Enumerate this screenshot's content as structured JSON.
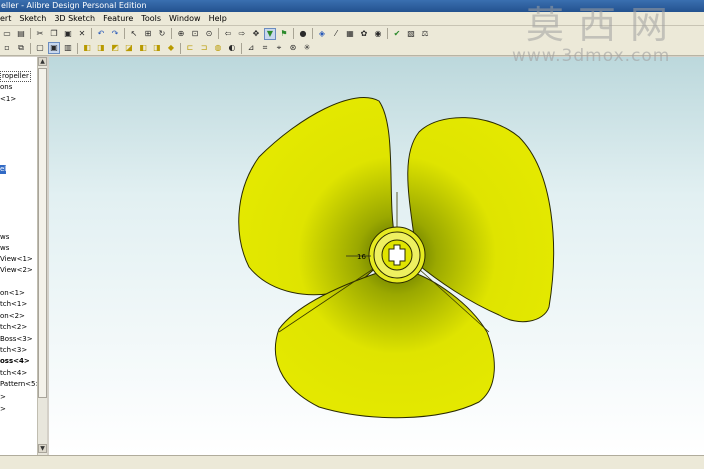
{
  "window": {
    "title": "eller - Alibre Design Personal Edition"
  },
  "menu": [
    {
      "id": "insert",
      "label": "ert"
    },
    {
      "id": "sketch",
      "label": "Sketch"
    },
    {
      "id": "3d-sketch",
      "label": "3D Sketch"
    },
    {
      "id": "feature",
      "label": "Feature"
    },
    {
      "id": "tools",
      "label": "Tools"
    },
    {
      "id": "window",
      "label": "Window"
    },
    {
      "id": "help",
      "label": "Help"
    }
  ],
  "tree": {
    "items": [
      {
        "label": "ropeller"
      },
      {
        "label": "ons"
      },
      {
        "label": "<1>"
      },
      {
        "label": "el"
      },
      {
        "label": "ws"
      },
      {
        "label": "ws"
      },
      {
        "label": "View<1>"
      },
      {
        "label": "View<2>"
      },
      {
        "label": "on<1>"
      },
      {
        "label": "tch<1>"
      },
      {
        "label": "on<2>"
      },
      {
        "label": "tch<2>"
      },
      {
        "label": "Boss<3>"
      },
      {
        "label": "tch<3>"
      },
      {
        "label": "oss<4>"
      },
      {
        "label": "tch<4>"
      },
      {
        "label": "Pattern<5>"
      }
    ]
  },
  "viewport": {
    "dimension_label": "16",
    "colors": {
      "blade": "#e8ec00",
      "background_top": "#bcd8dc",
      "background_bottom": "#ffffff"
    }
  },
  "watermark": {
    "brand": "莫西网",
    "url": "www.3dmox.com"
  }
}
